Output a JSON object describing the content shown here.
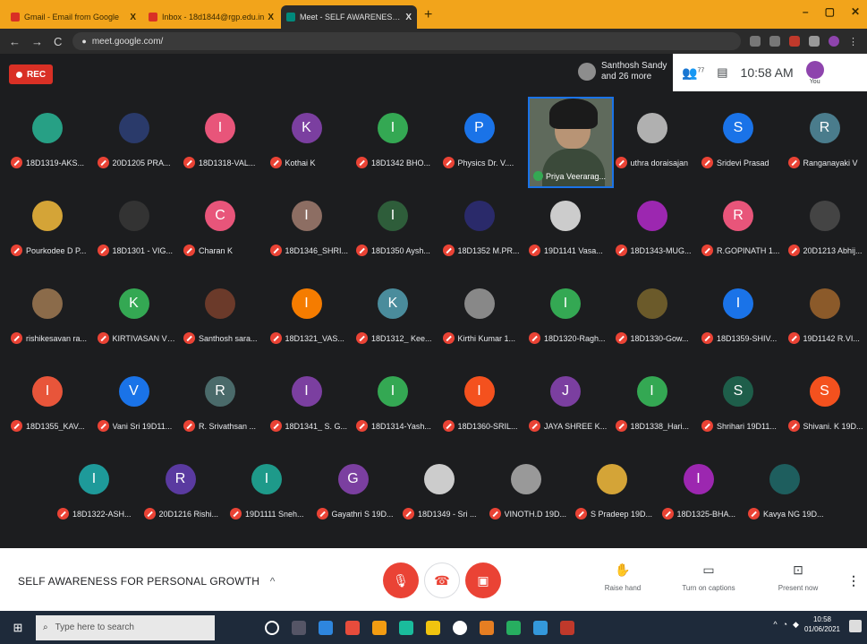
{
  "browser": {
    "tabs": [
      {
        "title": "Gmail - Email from Google",
        "favicon_color": "#d93025"
      },
      {
        "title": "Inbox - 18d1844@rgp.edu.in",
        "favicon_color": "#d93025"
      },
      {
        "title": "Meet - SELF AWARENESS F",
        "favicon_color": "#00897b"
      }
    ],
    "url": "meet.google.com/",
    "new_tab_label": "+",
    "close_label": "X",
    "window_minimize": "–",
    "window_maximize": "▢",
    "window_close": "✕"
  },
  "meet": {
    "rec_label": "REC",
    "presenter_name": "Santhosh Sandy",
    "presenter_more": "and 26 more",
    "people_count": "77",
    "time": "10:58 AM",
    "you_label": "You",
    "participants": [
      {
        "name": "18D1319-AKS...",
        "initial": "",
        "color": "#27a085"
      },
      {
        "name": "20D1205 PRA...",
        "initial": "",
        "color": "#2a3a6a"
      },
      {
        "name": "18D1318-VAL...",
        "initial": "I",
        "color": "#e8557a"
      },
      {
        "name": "Kothai K",
        "initial": "K",
        "color": "#7b3fa0"
      },
      {
        "name": "18D1342 BHO...",
        "initial": "I",
        "color": "#34a853"
      },
      {
        "name": "Physics Dr. V....",
        "initial": "P",
        "color": "#1a73e8"
      },
      {
        "name": "Priya Veerarag...",
        "initial": "",
        "color": ""
      },
      {
        "name": "uthra doraisajan",
        "initial": "",
        "color": "#b0b0b0"
      },
      {
        "name": "Sridevi Prasad",
        "initial": "S",
        "color": "#1a73e8"
      },
      {
        "name": "Ranganayaki V",
        "initial": "R",
        "color": "#4a7c8c"
      },
      {
        "name": "Pourkodee D P...",
        "initial": "",
        "color": "#d4a437"
      },
      {
        "name": "18D1301 - VIG...",
        "initial": "",
        "color": "#333333"
      },
      {
        "name": "Charan K",
        "initial": "C",
        "color": "#e8557a"
      },
      {
        "name": "18D1346_SHRI...",
        "initial": "I",
        "color": "#8d6e63"
      },
      {
        "name": "18D1350 Aysh...",
        "initial": "I",
        "color": "#2e5d3a"
      },
      {
        "name": "18D1352 M.PR...",
        "initial": "",
        "color": "#2a2a6a"
      },
      {
        "name": "19D1141 Vasa...",
        "initial": "",
        "color": "#cccccc"
      },
      {
        "name": "18D1343-MUG...",
        "initial": "",
        "color": "#9c27b0"
      },
      {
        "name": "R.GOPINATH 1...",
        "initial": "R",
        "color": "#e8557a"
      },
      {
        "name": "20D1213 Abhij...",
        "initial": "",
        "color": "#444444"
      },
      {
        "name": "rishikesavan ra...",
        "initial": "",
        "color": "#8b6b4a"
      },
      {
        "name": "KIRTIVASAN V ...",
        "initial": "K",
        "color": "#34a853"
      },
      {
        "name": "Santhosh sara...",
        "initial": "",
        "color": "#6b3a2a"
      },
      {
        "name": "18D1321_VAS...",
        "initial": "I",
        "color": "#f57c00"
      },
      {
        "name": "18D1312_ Kee...",
        "initial": "K",
        "color": "#4a8c9c"
      },
      {
        "name": "Kirthi Kumar 1...",
        "initial": "",
        "color": "#888888"
      },
      {
        "name": "18D1320-Ragh...",
        "initial": "I",
        "color": "#34a853"
      },
      {
        "name": "18D1330-Gow...",
        "initial": "",
        "color": "#6b5a2a"
      },
      {
        "name": "18D1359-SHIV...",
        "initial": "I",
        "color": "#1a73e8"
      },
      {
        "name": "19D1142 R.VI...",
        "initial": "",
        "color": "#8b5a2a"
      },
      {
        "name": "18D1355_KAV...",
        "initial": "I",
        "color": "#e8553a"
      },
      {
        "name": "Vani Sri 19D11...",
        "initial": "V",
        "color": "#1a73e8"
      },
      {
        "name": "R. Srivathsan ...",
        "initial": "R",
        "color": "#4a6a6a"
      },
      {
        "name": "18D1341_ S. G...",
        "initial": "I",
        "color": "#7b3fa0"
      },
      {
        "name": "18D1314-Yash...",
        "initial": "I",
        "color": "#34a853"
      },
      {
        "name": "18D1360-SRIL...",
        "initial": "I",
        "color": "#f4511e"
      },
      {
        "name": "JAYA SHREE K...",
        "initial": "J",
        "color": "#7b3fa0"
      },
      {
        "name": "18D1338_Hari...",
        "initial": "I",
        "color": "#34a853"
      },
      {
        "name": "Shrihari 19D11...",
        "initial": "S",
        "color": "#1e5e4a"
      },
      {
        "name": "Shivani. K 19D...",
        "initial": "S",
        "color": "#f4511e"
      },
      {
        "name": "18D1322-ASH...",
        "initial": "I",
        "color": "#1e9a9a"
      },
      {
        "name": "20D1216 Rishi...",
        "initial": "R",
        "color": "#5a3aa0"
      },
      {
        "name": "19D1111 Sneh...",
        "initial": "I",
        "color": "#1e9a8a"
      },
      {
        "name": "Gayathri S 19D...",
        "initial": "G",
        "color": "#7b3fa0"
      },
      {
        "name": "18D1349 - Sri ...",
        "initial": "",
        "color": "#cccccc"
      },
      {
        "name": "VINOTH.D 19D...",
        "initial": "",
        "color": "#999999"
      },
      {
        "name": "S Pradeep 19D...",
        "initial": "",
        "color": "#d4a437"
      },
      {
        "name": "18D1325-BHA...",
        "initial": "I",
        "color": "#9c27b0"
      },
      {
        "name": "Kavya NG 19D...",
        "initial": "",
        "color": "#1e5e5e"
      }
    ]
  },
  "bottom": {
    "meeting_title": "SELF AWARENESS FOR PERSONAL GROWTH",
    "chevron": "^",
    "raise_hand": "Raise hand",
    "captions": "Turn on captions",
    "present": "Present now",
    "more": "⋮"
  },
  "taskbar": {
    "search_placeholder": "Type here to search",
    "clock_time": "10:58",
    "clock_date": "01/06/2021"
  }
}
